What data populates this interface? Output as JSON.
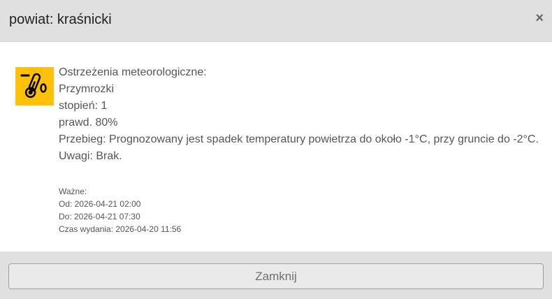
{
  "header": {
    "title": "powiat: kraśnicki",
    "close_symbol": "×"
  },
  "warning": {
    "icon": "thermometer-frost-icon",
    "icon_color": "#ffc107",
    "heading": "Ostrzeżenia meteorologiczne:",
    "type": "Przymrozki",
    "level": "stopień: 1",
    "probability": "prawd. 80%",
    "course": "Przebieg: Prognozowany jest spadek temperatury powietrza do około -1°C, przy gruncie do -2°C.",
    "remarks": "Uwagi: Brak."
  },
  "validity": {
    "label": "Ważne:",
    "from": "Od: 2026-04-21 02:00",
    "to": "Do: 2026-04-21 07:30",
    "issued": "Czas wydania: 2026-04-20 11:56"
  },
  "footer": {
    "close_label": "Zamknij"
  }
}
